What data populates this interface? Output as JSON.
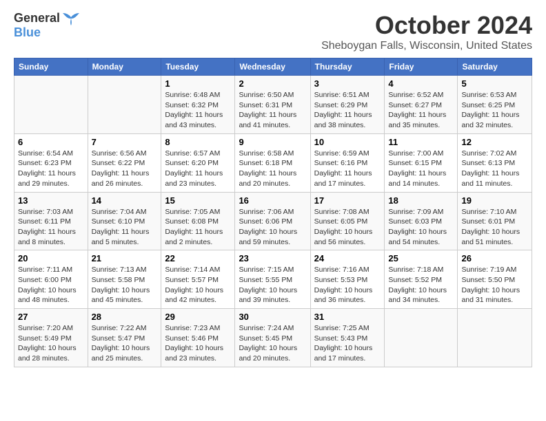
{
  "logo": {
    "general": "General",
    "blue": "Blue"
  },
  "title": {
    "month": "October 2024",
    "location": "Sheboygan Falls, Wisconsin, United States"
  },
  "days_of_week": [
    "Sunday",
    "Monday",
    "Tuesday",
    "Wednesday",
    "Thursday",
    "Friday",
    "Saturday"
  ],
  "weeks": [
    [
      {
        "day": "",
        "sunrise": "",
        "sunset": "",
        "daylight": ""
      },
      {
        "day": "",
        "sunrise": "",
        "sunset": "",
        "daylight": ""
      },
      {
        "day": "1",
        "sunrise": "Sunrise: 6:48 AM",
        "sunset": "Sunset: 6:32 PM",
        "daylight": "Daylight: 11 hours and 43 minutes."
      },
      {
        "day": "2",
        "sunrise": "Sunrise: 6:50 AM",
        "sunset": "Sunset: 6:31 PM",
        "daylight": "Daylight: 11 hours and 41 minutes."
      },
      {
        "day": "3",
        "sunrise": "Sunrise: 6:51 AM",
        "sunset": "Sunset: 6:29 PM",
        "daylight": "Daylight: 11 hours and 38 minutes."
      },
      {
        "day": "4",
        "sunrise": "Sunrise: 6:52 AM",
        "sunset": "Sunset: 6:27 PM",
        "daylight": "Daylight: 11 hours and 35 minutes."
      },
      {
        "day": "5",
        "sunrise": "Sunrise: 6:53 AM",
        "sunset": "Sunset: 6:25 PM",
        "daylight": "Daylight: 11 hours and 32 minutes."
      }
    ],
    [
      {
        "day": "6",
        "sunrise": "Sunrise: 6:54 AM",
        "sunset": "Sunset: 6:23 PM",
        "daylight": "Daylight: 11 hours and 29 minutes."
      },
      {
        "day": "7",
        "sunrise": "Sunrise: 6:56 AM",
        "sunset": "Sunset: 6:22 PM",
        "daylight": "Daylight: 11 hours and 26 minutes."
      },
      {
        "day": "8",
        "sunrise": "Sunrise: 6:57 AM",
        "sunset": "Sunset: 6:20 PM",
        "daylight": "Daylight: 11 hours and 23 minutes."
      },
      {
        "day": "9",
        "sunrise": "Sunrise: 6:58 AM",
        "sunset": "Sunset: 6:18 PM",
        "daylight": "Daylight: 11 hours and 20 minutes."
      },
      {
        "day": "10",
        "sunrise": "Sunrise: 6:59 AM",
        "sunset": "Sunset: 6:16 PM",
        "daylight": "Daylight: 11 hours and 17 minutes."
      },
      {
        "day": "11",
        "sunrise": "Sunrise: 7:00 AM",
        "sunset": "Sunset: 6:15 PM",
        "daylight": "Daylight: 11 hours and 14 minutes."
      },
      {
        "day": "12",
        "sunrise": "Sunrise: 7:02 AM",
        "sunset": "Sunset: 6:13 PM",
        "daylight": "Daylight: 11 hours and 11 minutes."
      }
    ],
    [
      {
        "day": "13",
        "sunrise": "Sunrise: 7:03 AM",
        "sunset": "Sunset: 6:11 PM",
        "daylight": "Daylight: 11 hours and 8 minutes."
      },
      {
        "day": "14",
        "sunrise": "Sunrise: 7:04 AM",
        "sunset": "Sunset: 6:10 PM",
        "daylight": "Daylight: 11 hours and 5 minutes."
      },
      {
        "day": "15",
        "sunrise": "Sunrise: 7:05 AM",
        "sunset": "Sunset: 6:08 PM",
        "daylight": "Daylight: 11 hours and 2 minutes."
      },
      {
        "day": "16",
        "sunrise": "Sunrise: 7:06 AM",
        "sunset": "Sunset: 6:06 PM",
        "daylight": "Daylight: 10 hours and 59 minutes."
      },
      {
        "day": "17",
        "sunrise": "Sunrise: 7:08 AM",
        "sunset": "Sunset: 6:05 PM",
        "daylight": "Daylight: 10 hours and 56 minutes."
      },
      {
        "day": "18",
        "sunrise": "Sunrise: 7:09 AM",
        "sunset": "Sunset: 6:03 PM",
        "daylight": "Daylight: 10 hours and 54 minutes."
      },
      {
        "day": "19",
        "sunrise": "Sunrise: 7:10 AM",
        "sunset": "Sunset: 6:01 PM",
        "daylight": "Daylight: 10 hours and 51 minutes."
      }
    ],
    [
      {
        "day": "20",
        "sunrise": "Sunrise: 7:11 AM",
        "sunset": "Sunset: 6:00 PM",
        "daylight": "Daylight: 10 hours and 48 minutes."
      },
      {
        "day": "21",
        "sunrise": "Sunrise: 7:13 AM",
        "sunset": "Sunset: 5:58 PM",
        "daylight": "Daylight: 10 hours and 45 minutes."
      },
      {
        "day": "22",
        "sunrise": "Sunrise: 7:14 AM",
        "sunset": "Sunset: 5:57 PM",
        "daylight": "Daylight: 10 hours and 42 minutes."
      },
      {
        "day": "23",
        "sunrise": "Sunrise: 7:15 AM",
        "sunset": "Sunset: 5:55 PM",
        "daylight": "Daylight: 10 hours and 39 minutes."
      },
      {
        "day": "24",
        "sunrise": "Sunrise: 7:16 AM",
        "sunset": "Sunset: 5:53 PM",
        "daylight": "Daylight: 10 hours and 36 minutes."
      },
      {
        "day": "25",
        "sunrise": "Sunrise: 7:18 AM",
        "sunset": "Sunset: 5:52 PM",
        "daylight": "Daylight: 10 hours and 34 minutes."
      },
      {
        "day": "26",
        "sunrise": "Sunrise: 7:19 AM",
        "sunset": "Sunset: 5:50 PM",
        "daylight": "Daylight: 10 hours and 31 minutes."
      }
    ],
    [
      {
        "day": "27",
        "sunrise": "Sunrise: 7:20 AM",
        "sunset": "Sunset: 5:49 PM",
        "daylight": "Daylight: 10 hours and 28 minutes."
      },
      {
        "day": "28",
        "sunrise": "Sunrise: 7:22 AM",
        "sunset": "Sunset: 5:47 PM",
        "daylight": "Daylight: 10 hours and 25 minutes."
      },
      {
        "day": "29",
        "sunrise": "Sunrise: 7:23 AM",
        "sunset": "Sunset: 5:46 PM",
        "daylight": "Daylight: 10 hours and 23 minutes."
      },
      {
        "day": "30",
        "sunrise": "Sunrise: 7:24 AM",
        "sunset": "Sunset: 5:45 PM",
        "daylight": "Daylight: 10 hours and 20 minutes."
      },
      {
        "day": "31",
        "sunrise": "Sunrise: 7:25 AM",
        "sunset": "Sunset: 5:43 PM",
        "daylight": "Daylight: 10 hours and 17 minutes."
      },
      {
        "day": "",
        "sunrise": "",
        "sunset": "",
        "daylight": ""
      },
      {
        "day": "",
        "sunrise": "",
        "sunset": "",
        "daylight": ""
      }
    ]
  ]
}
